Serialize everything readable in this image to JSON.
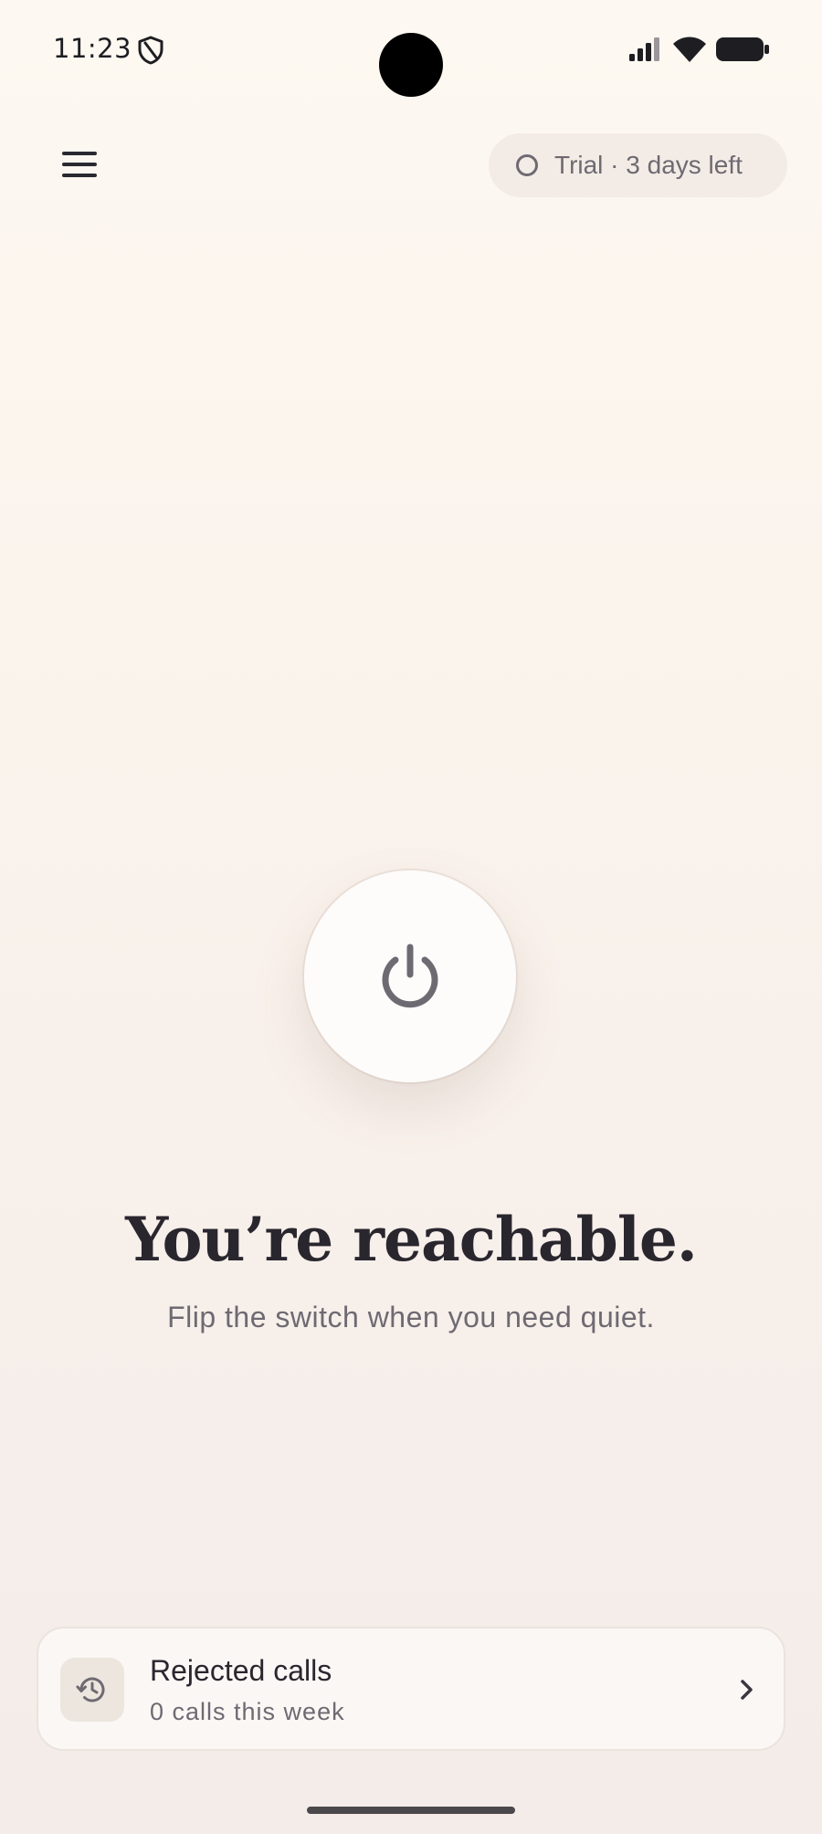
{
  "status_bar": {
    "time": "11:23",
    "icons": [
      "shield-icon",
      "signal-icon",
      "wifi-icon",
      "battery-icon"
    ]
  },
  "header": {
    "menu_icon": "menu-icon",
    "trial_badge": "Trial · 3 days left"
  },
  "main": {
    "power_icon": "power-icon",
    "headline": "You’re reachable.",
    "subheadline": "Flip the switch when you need quiet."
  },
  "rejected_calls_card": {
    "icon": "history-icon",
    "title": "Rejected calls",
    "subtitle": "0 calls this week",
    "chevron": "chevron-right-icon"
  },
  "colors": {
    "background_top": "#fdf8f1",
    "background_bottom": "#f4ece9",
    "text_primary": "#29262e",
    "text_secondary": "#6e6a72",
    "trial_pill": "#f3ece6",
    "power_button": "#fdfcfb",
    "history_tile": "#ede6de"
  }
}
